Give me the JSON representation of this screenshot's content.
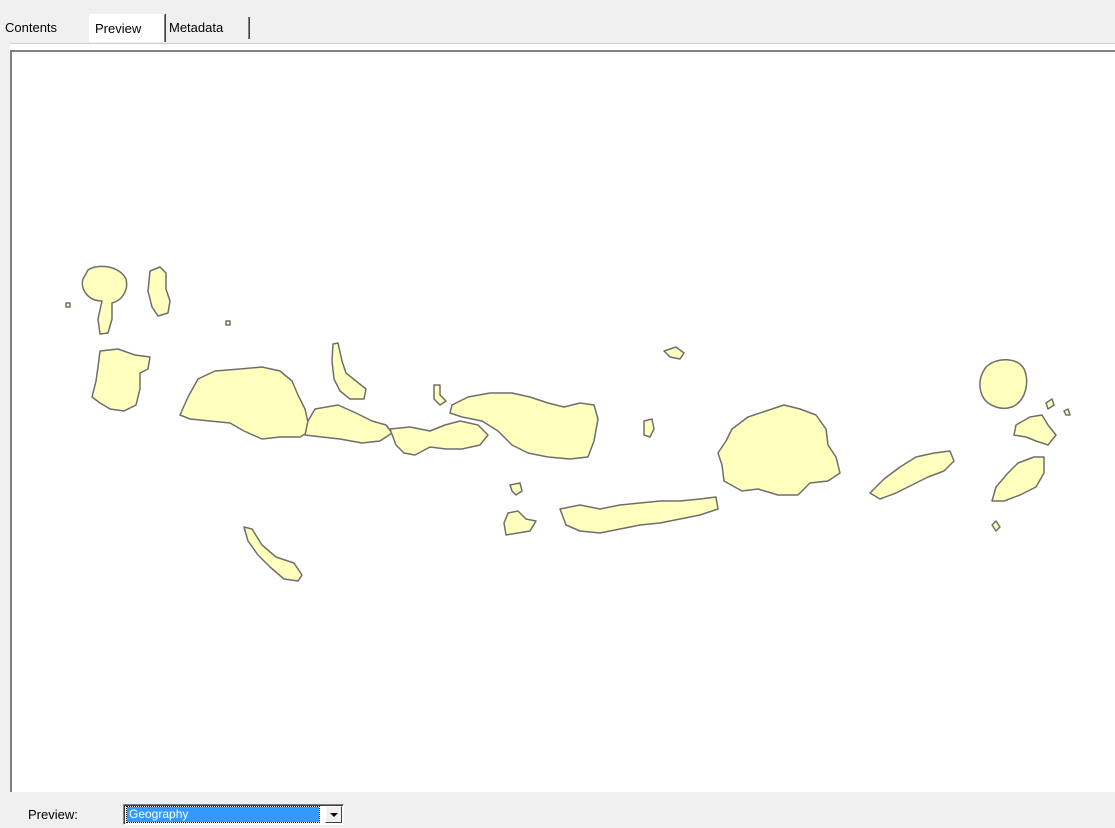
{
  "tabs": [
    {
      "label": "Contents",
      "active": false
    },
    {
      "label": "Preview",
      "active": true
    },
    {
      "label": "Metadata",
      "active": false
    }
  ],
  "preview": {
    "label": "Preview:",
    "selected": "Geography"
  },
  "colors": {
    "land_fill": "#ffffbe",
    "land_outline": "#6e6e6e",
    "selection": "#3399ff"
  },
  "icons": {
    "dropdown": "chevron-down-icon"
  }
}
